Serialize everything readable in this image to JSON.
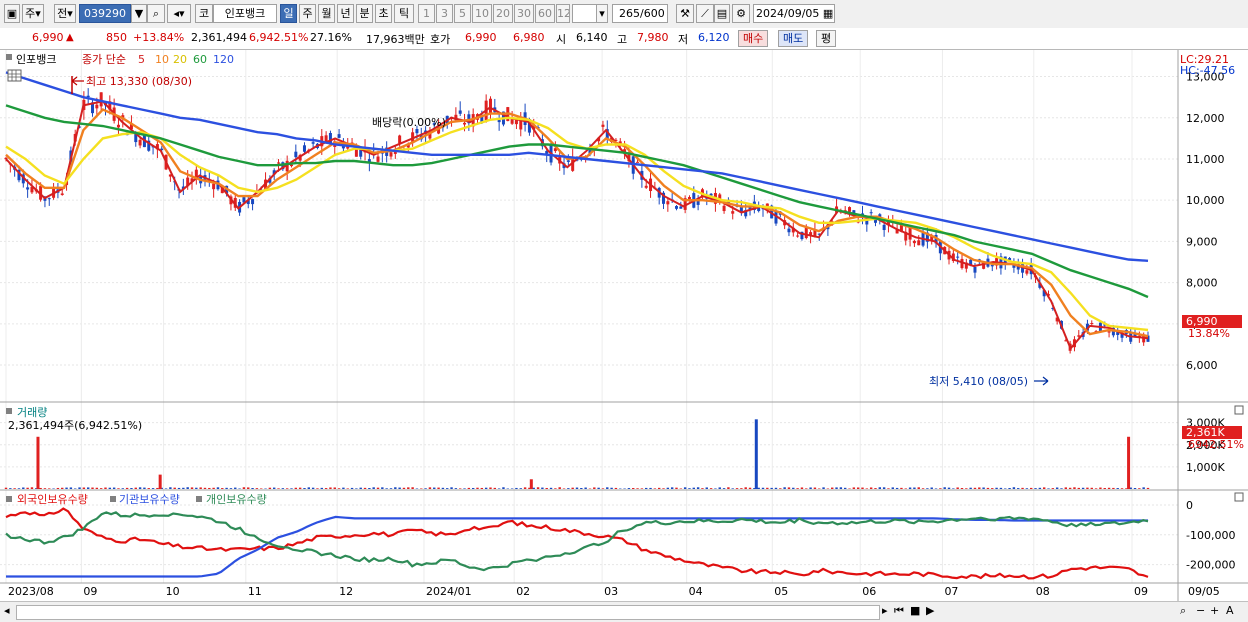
{
  "toolbar": {
    "market_label": "주",
    "prev_label": "전",
    "code_value": "039290",
    "product_label": "코",
    "stock_name": "인포뱅크",
    "periods": [
      "일",
      "주",
      "월",
      "년",
      "분",
      "초",
      "틱"
    ],
    "intervals": [
      "1",
      "3",
      "5",
      "10",
      "20",
      "30",
      "60",
      "120"
    ],
    "count_value": "265",
    "count_max": "/600",
    "date_value": "2024/09/05"
  },
  "infobar": {
    "price": "6,990",
    "up_arrow": "▲",
    "change": "850",
    "change_pct": "+13.84%",
    "volume": "2,361,494",
    "volume_pct": "6,942.51%",
    "turnover": "27.16%",
    "amount": "17,963백만",
    "bid_label": "호가",
    "ask_price": "6,990",
    "bid_price": "6,980",
    "open_label": "시",
    "open": "6,140",
    "high_label": "고",
    "high": "7,980",
    "low_label": "저",
    "low": "6,120",
    "buy_label": "매수",
    "sell_label": "매도",
    "avg_label": "평"
  },
  "price_panel": {
    "title": "인포뱅크",
    "ma_title": "종가 단순",
    "ma_periods": [
      "5",
      "10",
      "20",
      "60",
      "120"
    ],
    "lc_label": "LC:29.21",
    "hc_label": "HC:-47.56",
    "high_annotation": "최고 13,330 (08/30)",
    "low_annotation": "최저 5,410 (08/05)",
    "dividend_annotation": "배당락(0.00%)",
    "last_price_label": "6,990",
    "last_pct_label": "13.84%"
  },
  "volume_panel": {
    "title": "거래량",
    "value_label": "2,361,494주(6,942.51%)",
    "last_label": "2,361K",
    "last_pct_label": "6942.51%"
  },
  "holdings_panel": {
    "series_names": [
      "외국인보유수량",
      "기관보유수량",
      "개인보유수량"
    ]
  },
  "chart_data": {
    "type": "line",
    "price": {
      "ylim": [
        5200,
        13450
      ],
      "yticks": [
        6000,
        7000,
        8000,
        9000,
        10000,
        11000,
        12000,
        13000
      ],
      "ytick_labels": [
        "6,000",
        "7,000",
        "8,000",
        "9,000",
        "10,000",
        "11,000",
        "12,000",
        "13,000"
      ],
      "ma_series": [
        {
          "name": "5",
          "color": "#d42020",
          "values": [
            11000,
            10500,
            10050,
            10300,
            12300,
            12400,
            11900,
            11500,
            11200,
            10200,
            10600,
            10400,
            9800,
            10200,
            10700,
            11000,
            11300,
            11500,
            11300,
            11100,
            11300,
            11500,
            11700,
            12000,
            11900,
            12250,
            12000,
            11900,
            11200,
            10800,
            11200,
            11700,
            11100,
            10500,
            10100,
            9850,
            10100,
            9950,
            9700,
            9850,
            9550,
            9200,
            9100,
            9750,
            9600,
            9550,
            9300,
            9100,
            9000,
            8550,
            8400,
            8500,
            8450,
            8300,
            7550,
            6400,
            6950,
            6900,
            6700,
            6650
          ]
        },
        {
          "name": "10",
          "color": "#f08020",
          "values": [
            11100,
            10650,
            10300,
            10300,
            11700,
            12200,
            12000,
            11700,
            11400,
            10700,
            10500,
            10400,
            10100,
            10100,
            10500,
            10800,
            11100,
            11400,
            11350,
            11150,
            11200,
            11400,
            11650,
            11900,
            11950,
            12100,
            12100,
            11950,
            11500,
            11000,
            11050,
            11500,
            11300,
            10850,
            10350,
            10000,
            10000,
            9950,
            9850,
            9850,
            9700,
            9400,
            9250,
            9500,
            9600,
            9600,
            9450,
            9300,
            9100,
            8800,
            8550,
            8450,
            8450,
            8350,
            7950,
            7200,
            6750,
            6850,
            6800,
            6700
          ]
        },
        {
          "name": "20",
          "color": "#f5e020",
          "values": [
            11300,
            11000,
            10600,
            10400,
            11000,
            11500,
            11600,
            11650,
            11500,
            11100,
            10800,
            10600,
            10300,
            10200,
            10300,
            10500,
            10800,
            11100,
            11250,
            11250,
            11200,
            11250,
            11450,
            11650,
            11800,
            11950,
            12000,
            11950,
            11750,
            11400,
            11250,
            11350,
            11350,
            11100,
            10700,
            10350,
            10150,
            10000,
            9950,
            9850,
            9800,
            9600,
            9450,
            9450,
            9500,
            9550,
            9500,
            9450,
            9300,
            9100,
            8850,
            8650,
            8500,
            8450,
            8250,
            7750,
            7200,
            6950,
            6900,
            6850
          ]
        },
        {
          "name": "60",
          "color": "#1e9a3c",
          "values": [
            12300,
            12150,
            12000,
            11900,
            11850,
            11800,
            11700,
            11600,
            11500,
            11350,
            11200,
            11050,
            10950,
            10850,
            10850,
            10900,
            10900,
            10950,
            10950,
            10900,
            10850,
            10850,
            10900,
            11000,
            11100,
            11200,
            11300,
            11350,
            11350,
            11300,
            11250,
            11200,
            11150,
            11050,
            10950,
            10850,
            10700,
            10550,
            10400,
            10250,
            10100,
            9950,
            9850,
            9750,
            9650,
            9550,
            9450,
            9350,
            9250,
            9150,
            9000,
            8900,
            8800,
            8700,
            8500,
            8300,
            8150,
            8000,
            7850,
            7650
          ]
        },
        {
          "name": "120",
          "color": "#2c50e0",
          "values": [
            13100,
            12950,
            12800,
            12650,
            12500,
            12400,
            12300,
            12200,
            12100,
            12000,
            11950,
            11850,
            11750,
            11650,
            11600,
            11500,
            11450,
            11350,
            11300,
            11250,
            11200,
            11150,
            11100,
            11100,
            11100,
            11100,
            11100,
            11150,
            11100,
            11050,
            11000,
            10950,
            10900,
            10850,
            10800,
            10750,
            10700,
            10650,
            10550,
            10450,
            10350,
            10250,
            10150,
            10050,
            9950,
            9850,
            9750,
            9650,
            9550,
            9450,
            9350,
            9250,
            9150,
            9050,
            8950,
            8850,
            8750,
            8650,
            8560,
            8530
          ]
        }
      ]
    },
    "volume": {
      "yticks": [
        1000,
        2000,
        3000
      ],
      "ytick_labels": [
        "1,000K",
        "2,000K",
        "3,000K"
      ],
      "spikes": [
        {
          "x": 0.028,
          "value": 2361
        },
        {
          "x": 0.135,
          "value": 650
        },
        {
          "x": 0.46,
          "value": 440
        },
        {
          "x": 0.657,
          "value": 3150
        },
        {
          "x": 0.983,
          "value": 2361
        }
      ]
    },
    "holdings": {
      "yticks": [
        0,
        -100000,
        -200000
      ],
      "ytick_labels": [
        "0",
        "-100,000",
        "-200,000"
      ],
      "ylim": [
        -255000,
        30000
      ],
      "series": [
        {
          "name": "외국인보유수량",
          "color": "#e01010",
          "values": [
            -40000,
            -20000,
            -40000,
            -10000,
            -80000,
            -110000,
            -120000,
            -115000,
            -130000,
            -140000,
            -145000,
            -150000,
            -150000,
            -145000,
            -145000,
            -130000,
            -110000,
            -105000,
            -100000,
            -95000,
            -100000,
            -85000,
            -95000,
            -100000,
            -75000,
            -80000,
            -55000,
            -70000,
            -75000,
            -85000,
            -95000,
            -105000,
            -120000,
            -150000,
            -170000,
            -185000,
            -200000,
            -210000,
            -220000,
            -225000,
            -225000,
            -235000,
            -220000,
            -225000,
            -230000,
            -230000,
            -232000,
            -230000,
            -235000,
            -238000,
            -240000,
            -238000,
            -236000,
            -240000,
            -238000,
            -215000,
            -210000,
            -210000,
            -215000,
            -245000
          ]
        },
        {
          "name": "기관보유수량",
          "color": "#2c50e0",
          "values": [
            -240000,
            -240000,
            -240000,
            -240000,
            -240000,
            -240000,
            -240000,
            -240000,
            -240000,
            -240000,
            -240000,
            -230000,
            -180000,
            -150000,
            -110000,
            -90000,
            -60000,
            -40000,
            -45000,
            -45000,
            -45000,
            -45000,
            -45000,
            -45000,
            -45000,
            -45000,
            -45000,
            -45000,
            -45000,
            -45000,
            -45000,
            -45000,
            -45000,
            -45000,
            -45000,
            -45000,
            -45000,
            -45000,
            -45000,
            -45000,
            -45000,
            -45000,
            -45000,
            -45000,
            -45000,
            -45000,
            -45000,
            -45000,
            -45000,
            -48000,
            -50000,
            -50000,
            -52000,
            -52000,
            -52000,
            -52000,
            -52000,
            -52000,
            -52000,
            -52000
          ]
        },
        {
          "name": "개인보유수량",
          "color": "#2e8b57",
          "values": [
            -100000,
            -115000,
            -125000,
            -110000,
            -80000,
            -25000,
            -35000,
            -35000,
            -30000,
            -30000,
            -40000,
            -55000,
            -80000,
            -110000,
            -135000,
            -145000,
            -160000,
            -170000,
            -180000,
            -185000,
            -180000,
            -200000,
            -195000,
            -185000,
            -210000,
            -215000,
            -200000,
            -185000,
            -175000,
            -160000,
            -145000,
            -120000,
            -80000,
            -60000,
            -60000,
            -55000,
            -55000,
            -55000,
            -50000,
            -55000,
            -60000,
            -50000,
            -60000,
            -60000,
            -60000,
            -55000,
            -55000,
            -55000,
            -55000,
            -50000,
            -45000,
            -45000,
            -45000,
            -45000,
            -55000,
            -70000,
            -60000,
            -65000,
            -60000,
            -50000
          ]
        }
      ]
    },
    "x_axis": {
      "labels": [
        "2023/08",
        "09",
        "10",
        "11",
        "12",
        "2024/01",
        "02",
        "03",
        "04",
        "05",
        "06",
        "07",
        "08",
        "09",
        "09/05"
      ]
    }
  }
}
